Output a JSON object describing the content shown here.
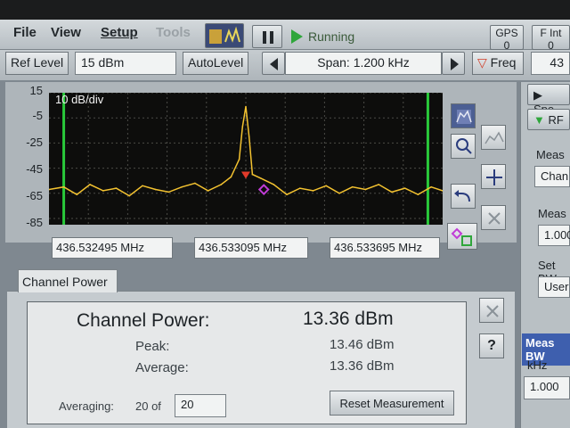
{
  "menu": {
    "file": "File",
    "view": "View",
    "setup": "Setup",
    "tools": "Tools"
  },
  "toolbar": {
    "run_state": "Running",
    "gps_label": "GPS",
    "gps_sub": "0",
    "fint_label": "F Int",
    "fint_sub": "0",
    "ref_level_label": "Ref Level",
    "ref_level_value": "15 dBm",
    "autolevel_label": "AutoLevel",
    "span_label": "Span:  1.200 kHz",
    "freq_label": "Freq",
    "freq_value": "43"
  },
  "plot": {
    "scale_label": "10 dB/div",
    "y_ticks": [
      "15",
      "-5",
      "-25",
      "-45",
      "-65",
      "-85"
    ],
    "freq_left": "436.532495 MHz",
    "freq_center": "436.533095 MHz",
    "freq_right": "436.533695 MHz"
  },
  "chart_data": {
    "type": "line",
    "title": "",
    "xlabel": "",
    "ylabel": "",
    "x_range_mhz": [
      436.532495,
      436.533695
    ],
    "ylim": [
      -90,
      15
    ],
    "y_ticks": [
      15,
      -5,
      -25,
      -45,
      -65,
      -85
    ],
    "grid": true,
    "series": [
      {
        "x": [
          436.532495,
          436.53254,
          436.53258,
          436.53262,
          436.53266,
          436.5327,
          436.53274,
          436.53278,
          436.53282,
          436.53286,
          436.5329,
          436.53294,
          436.53298,
          436.53302,
          436.53305,
          436.533075,
          436.533085,
          436.533095,
          436.533105,
          436.533115,
          436.53314,
          436.53318,
          436.53322,
          436.53326,
          436.5333,
          436.53334,
          436.53338,
          436.53342,
          436.53346,
          436.5335,
          436.53354,
          436.53358,
          436.53362,
          436.53366,
          436.533695
        ],
        "y": [
          -62,
          -60,
          -66,
          -58,
          -63,
          -61,
          -67,
          -59,
          -62,
          -64,
          -60,
          -57,
          -63,
          -58,
          -52,
          -38,
          -12,
          4,
          -20,
          -50,
          -53,
          -58,
          -66,
          -61,
          -63,
          -59,
          -65,
          -60,
          -62,
          -58,
          -64,
          -61,
          -66,
          -60,
          -63
        ]
      }
    ],
    "markers": [
      {
        "x": 436.533095,
        "y": -52,
        "shape": "triangle",
        "color": "#e23a2a"
      },
      {
        "x": 436.53315,
        "y": -62,
        "shape": "diamond",
        "color": "#c03cd6"
      }
    ],
    "vertical_lines_mhz": [
      436.53254,
      436.53365
    ],
    "vertical_line_color": "#29c93a",
    "trace_color": "#f3c230"
  },
  "measurement": {
    "tab_label": "Channel Power",
    "title_label": "Channel Power:",
    "title_value": "13.36 dBm",
    "peak_label": "Peak:",
    "peak_value": "13.46 dBm",
    "average_label": "Average:",
    "average_value": "13.36 dBm",
    "averaging_label": "Averaging:",
    "averaging_count": "20 of",
    "averaging_input": "20",
    "reset_label": "Reset Measurement",
    "help_label": "?"
  },
  "right_panel": {
    "spec_label": "Spe",
    "rf_label": "RF",
    "meas_label": "Meas",
    "chan_label": "Chan",
    "meas2_label": "Meas",
    "val1": "1.000",
    "setbw_label": "Set BW",
    "user_label": "User",
    "measbw_label": "Meas BW",
    "khz_label": "kHz",
    "bw_value": "1.000"
  }
}
